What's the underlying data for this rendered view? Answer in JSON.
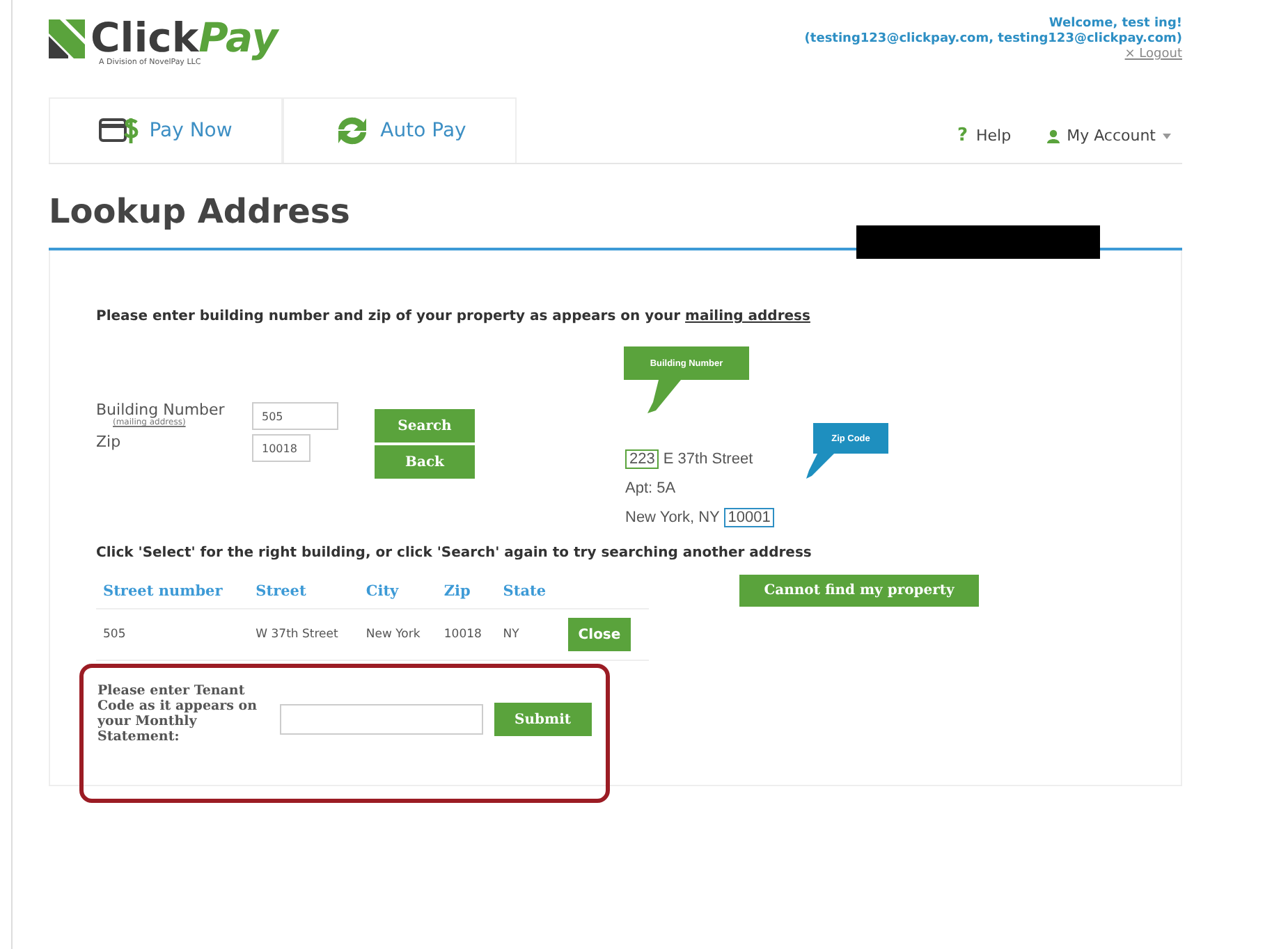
{
  "logo": {
    "first": "Click",
    "second": "Pay",
    "tagline": "A Division of NovelPay LLC"
  },
  "user": {
    "welcome": "Welcome, test ing!",
    "emails": "(testing123@clickpay.com, testing123@clickpay.com)",
    "logout": "× Logout"
  },
  "tabs": [
    {
      "label": "Pay Now",
      "selected": false
    },
    {
      "label": "Auto Pay",
      "selected": false
    }
  ],
  "nav_right": {
    "help": "Help",
    "help_mark": "?",
    "account": "My Account"
  },
  "title": "Lookup Address",
  "instruction": {
    "text": "Please enter building number and zip of your property as appears on your",
    "link": "mailing address"
  },
  "form": {
    "building_label": "Building Number",
    "building_sublabel": "(mailing address)",
    "building_value": "505",
    "zip_label": "Zip",
    "zip_value": "10018",
    "buttons": [
      "Search",
      "Back"
    ]
  },
  "example": {
    "building_callout": "Building Number",
    "zip_callout": "Zip Code",
    "number": "223",
    "street": "E 37th Street",
    "apt": "Apt: 5A",
    "city": "New York, NY",
    "zip": "10001"
  },
  "select_hint": "Click 'Select' for the right building, or click 'Search' again to try searching another address",
  "cannot_find": "Cannot find my property",
  "table": {
    "columns": [
      "Street number",
      "Street",
      "City",
      "Zip",
      "State"
    ],
    "rows": [
      {
        "cells": [
          "505",
          "W 37th Street",
          "New York",
          "10018",
          "NY"
        ],
        "action": "Close"
      }
    ]
  },
  "tenant": {
    "prompt": "Please enter Tenant Code as it appears on your Monthly Statement:",
    "submit": "Submit"
  }
}
